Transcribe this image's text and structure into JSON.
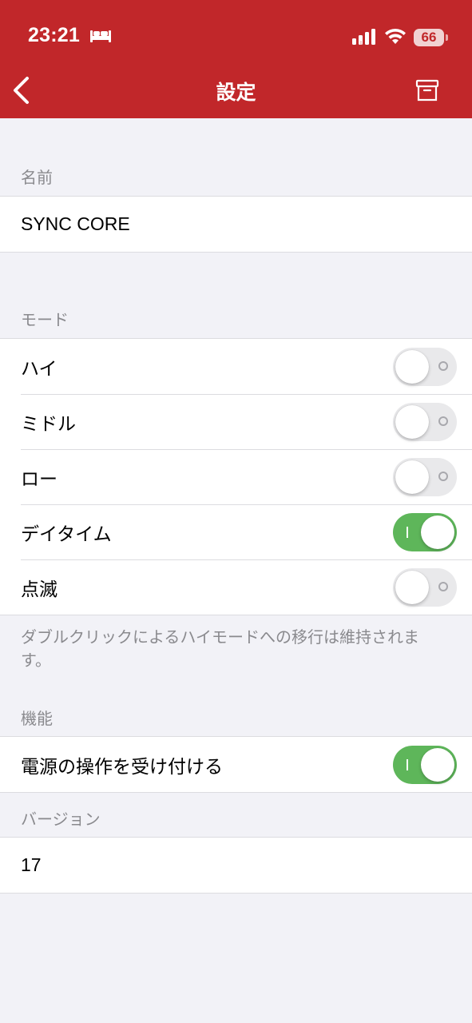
{
  "status_bar": {
    "time": "23:21",
    "sleep_icon": "bed-icon",
    "signal_icon": "cellular-signal-icon",
    "wifi_icon": "wifi-icon",
    "battery": "66"
  },
  "nav": {
    "title": "設定",
    "back_icon": "chevron-left-icon",
    "archive_icon": "archive-box-icon",
    "background": "#c1272a"
  },
  "name_section": {
    "header": "名前",
    "value": "SYNC CORE"
  },
  "mode_section": {
    "header": "モード",
    "items": [
      {
        "label": "ハイ",
        "enabled": false
      },
      {
        "label": "ミドル",
        "enabled": false
      },
      {
        "label": "ロー",
        "enabled": false
      },
      {
        "label": "デイタイム",
        "enabled": true
      },
      {
        "label": "点滅",
        "enabled": false
      }
    ],
    "footer": "ダブルクリックによるハイモードへの移行は維持されます。"
  },
  "function_section": {
    "header": "機能",
    "items": [
      {
        "label": "電源の操作を受け付ける",
        "enabled": true
      }
    ]
  },
  "version_section": {
    "header": "バージョン",
    "value": "17"
  },
  "colors": {
    "toggle_on": "#5eb65a",
    "toggle_off": "#e9e9eb",
    "background": "#f2f2f7"
  }
}
